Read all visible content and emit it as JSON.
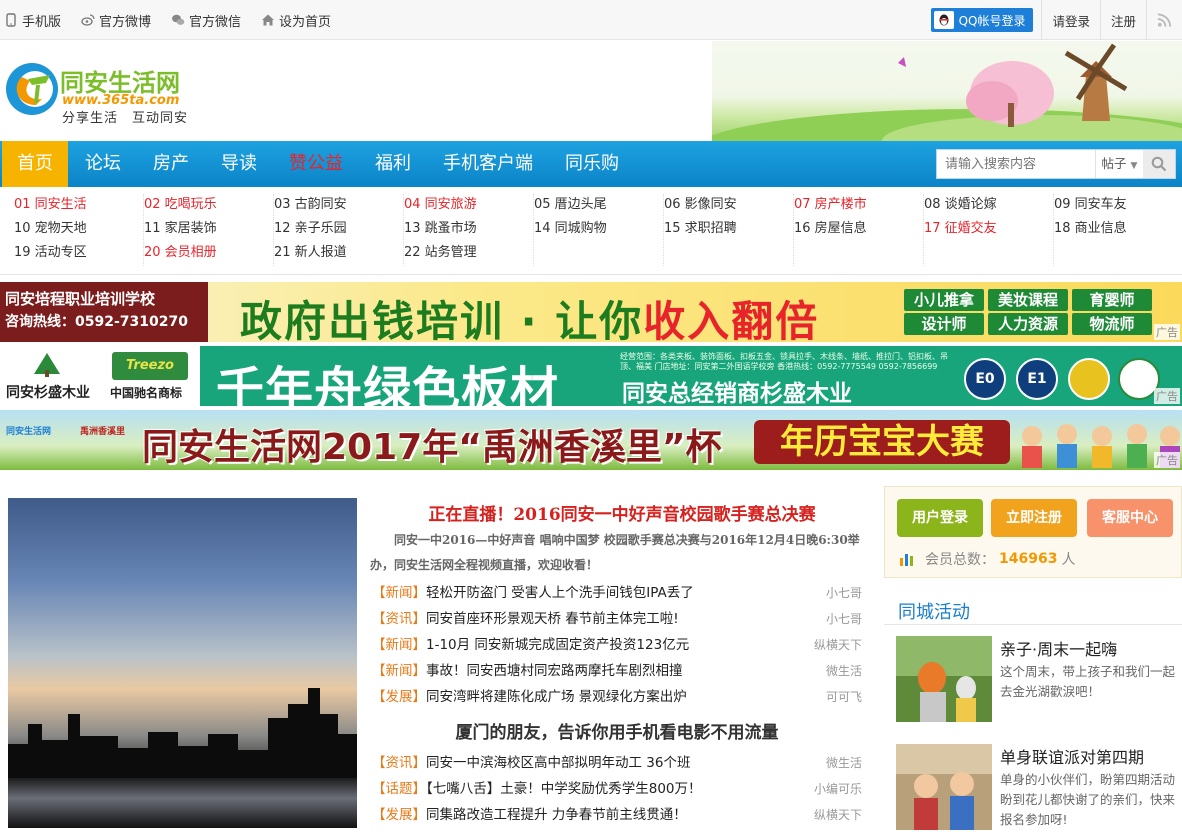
{
  "topbar": {
    "links": [
      {
        "label": "手机版",
        "icon": "phone-icon"
      },
      {
        "label": "官方微博",
        "icon": "weibo-icon"
      },
      {
        "label": "官方微信",
        "icon": "wechat-icon"
      },
      {
        "label": "设为首页",
        "icon": "home-icon"
      }
    ],
    "qq_login": "QQ帐号登录",
    "login": "请登录",
    "register": "注册",
    "rss_icon": "rss-icon"
  },
  "header": {
    "logo_title": "同安生活网",
    "logo_url": "www.365ta.com",
    "logo_slogan": "分享生活　互动同安"
  },
  "nav": {
    "items": [
      "首页",
      "论坛",
      "房产",
      "导读",
      "赞公益",
      "福利",
      "手机客户端",
      "同乐购"
    ],
    "active": "首页",
    "search_placeholder": "请输入搜索内容",
    "search_scope": "帖子"
  },
  "sublinks": {
    "columns": [
      [
        {
          "label": "01 同安生活",
          "hot": true
        },
        {
          "label": "10 宠物天地",
          "hot": false
        },
        {
          "label": "19 活动专区",
          "hot": false
        }
      ],
      [
        {
          "label": "02 吃喝玩乐",
          "hot": true
        },
        {
          "label": "11 家居装饰",
          "hot": false
        },
        {
          "label": "20 会员相册",
          "hot": true
        }
      ],
      [
        {
          "label": "03 古韵同安",
          "hot": false
        },
        {
          "label": "12 亲子乐园",
          "hot": false
        },
        {
          "label": "21 新人报道",
          "hot": false
        }
      ],
      [
        {
          "label": "04 同安旅游",
          "hot": true
        },
        {
          "label": "13 跳蚤市场",
          "hot": false
        },
        {
          "label": "22 站务管理",
          "hot": false
        }
      ],
      [
        {
          "label": "05 厝边头尾",
          "hot": false
        },
        {
          "label": "14 同城购物",
          "hot": false
        }
      ],
      [
        {
          "label": "06 影像同安",
          "hot": false
        },
        {
          "label": "15 求职招聘",
          "hot": false
        }
      ],
      [
        {
          "label": "07 房产楼市",
          "hot": true
        },
        {
          "label": "16 房屋信息",
          "hot": false
        }
      ],
      [
        {
          "label": "08 谈婚论嫁",
          "hot": false
        },
        {
          "label": "17 征婚交友",
          "hot": true
        }
      ],
      [
        {
          "label": "09 同安车友",
          "hot": false
        },
        {
          "label": "18 商业信息",
          "hot": false
        }
      ]
    ]
  },
  "ads": {
    "tag": "广告",
    "ad1": {
      "school": "同安培程职业培训学校",
      "phone": "咨询热线：0592-7310270",
      "slogan_a": "政府出钱培训 · 让你",
      "slogan_b": "收入翻倍",
      "courses": [
        "小儿推拿",
        "美妆课程",
        "育婴师",
        "设计师",
        "人力资源",
        "物流师"
      ]
    },
    "ad2": {
      "brand": "同安杉盛木业",
      "trademark": "中国驰名商标",
      "logo": "Treezo",
      "big": "千年舟绿色板材",
      "small": "经营范围：各类夹板、装饰面板、扣板五金、锁具拉手、木线条、墙纸、推拉门、铝扣板、吊顶、福美 门店地址：同安第二外国语学校旁 香港热线：0592-7775549 0592-7856699",
      "distributor": "同安总经销商杉盛木业",
      "certs": [
        "E0",
        "E1"
      ]
    },
    "ad3": {
      "logo_a": "同安生活网",
      "logo_b": "禹洲香溪里",
      "title": "同安生活网2017年“禹洲香溪里”杯",
      "badge": "年历宝宝大赛"
    }
  },
  "content": {
    "headline": "正在直播！2016同安一中好声音校园歌手赛总决赛",
    "summary": "同安一中2016—中好声音 唱响中国梦 校园歌手赛总决赛与2016年12月4日晚6:30举办，同安生活网全程视频直播，欢迎收看！",
    "news_top": [
      {
        "cat": "【新闻】",
        "title": "轻松开防盗门 受害人上个洗手间钱包IPA丢了",
        "author": "小七哥"
      },
      {
        "cat": "【资讯】",
        "title": "同安首座环形景观天桥 春节前主体完工啦!",
        "author": "小七哥"
      },
      {
        "cat": "【新闻】",
        "title": "1-10月 同安新城完成固定资产投资123亿元",
        "author": "纵横天下"
      },
      {
        "cat": "【新闻】",
        "title": "事故！同安西塘村同宏路两摩托车剧烈相撞",
        "author": "微生活"
      },
      {
        "cat": "【发展】",
        "title": "同安湾畔将建陈化成广场 景观绿化方案出炉",
        "author": "可可飞"
      }
    ],
    "mid_title": "厦门的朋友，告诉你用手机看电影不用流量",
    "news_bottom": [
      {
        "cat": "【资讯】",
        "title": "同安一中滨海校区高中部拟明年动工 36个班",
        "author": "微生活"
      },
      {
        "cat": "【话题】",
        "title": "【七嘴八舌】土豪！中学奖励优秀学生800万！",
        "author": "小编可乐"
      },
      {
        "cat": "【发展】",
        "title": "同集路改造工程提升 力争春节前主线贯通！",
        "author": "纵横天下"
      }
    ]
  },
  "sidebar": {
    "user_login": "用户登录",
    "register_now": "立即注册",
    "service_center": "客服中心",
    "members_label": "会员总数：",
    "members_count": "146963",
    "members_unit": "人",
    "section_title": "同城活动",
    "activities": [
      {
        "title": "亲子·周末一起嗨",
        "desc": "这个周末，带上孩子和我们一起去金光湖歡淚吧！"
      },
      {
        "title": "单身联谊派对第四期",
        "desc": "单身的小伙伴们，盼第四期活动盼到花儿都快谢了的亲们，快来报名参加呀!"
      }
    ]
  },
  "colors": {
    "nav_blue": "#0b84c8",
    "active_orange": "#f6b300",
    "hot_red": "#e8242b",
    "category_orange": "#e87a19",
    "link_blue": "#1a7fd0"
  }
}
